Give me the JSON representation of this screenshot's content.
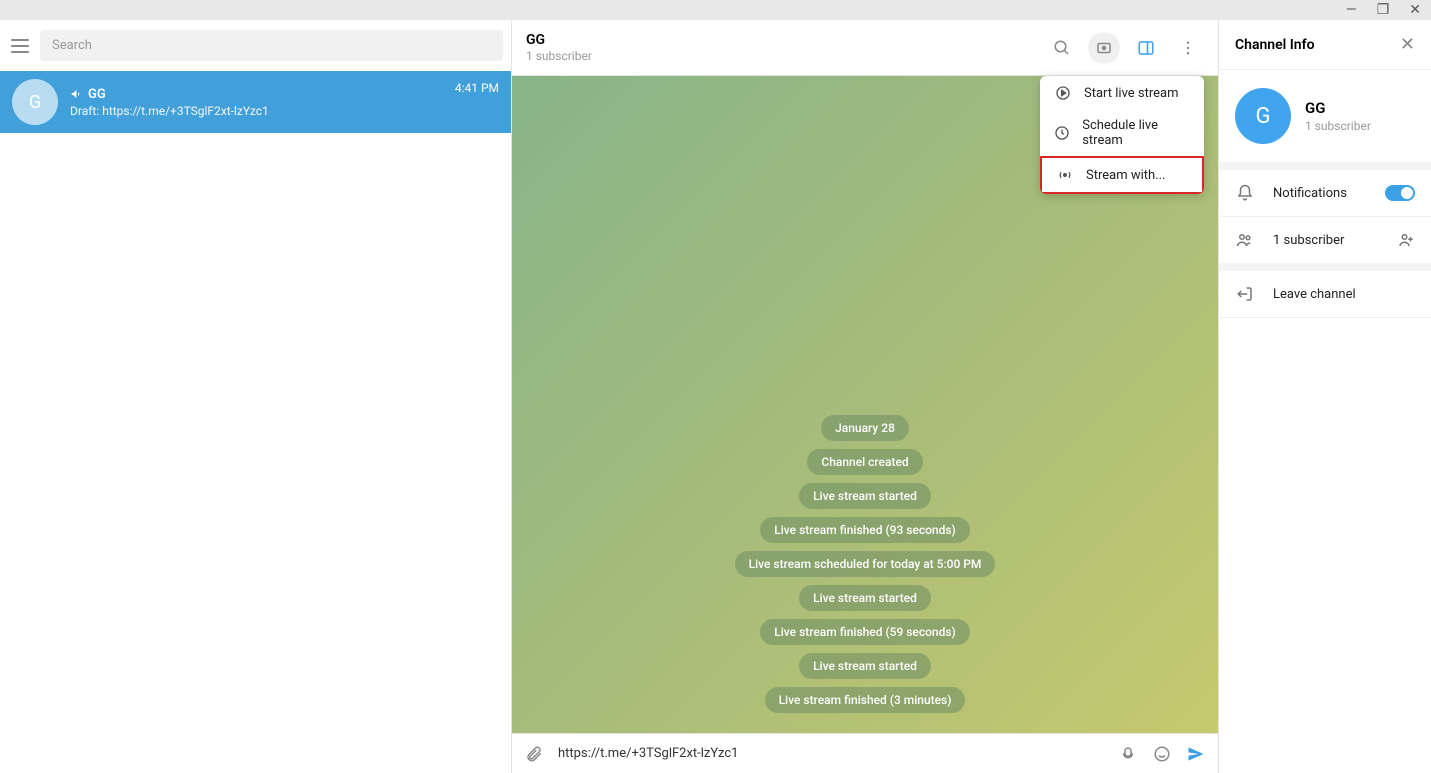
{
  "titlebar": {
    "minimize": "—",
    "maximize": "❐",
    "close": "✕"
  },
  "left": {
    "search_placeholder": "Search",
    "chat": {
      "avatar_letter": "G",
      "name": "GG",
      "time": "4:41 PM",
      "preview_label": "Draft: ",
      "preview_text": "https://t.me/+3TSglF2xt-lzYzc1"
    }
  },
  "middle": {
    "header": {
      "name": "GG",
      "sub": "1 subscriber"
    },
    "dropdown": [
      {
        "icon": "play",
        "label": "Start live stream"
      },
      {
        "icon": "clock",
        "label": "Schedule live stream"
      },
      {
        "icon": "broadcast",
        "label": "Stream with...",
        "highlight": true
      }
    ],
    "bubbles": [
      "January 28",
      "Channel created",
      "Live stream started",
      "Live stream finished (93 seconds)",
      "Live stream scheduled for today at 5:00 PM",
      "Live stream started",
      "Live stream finished (59 seconds)",
      "Live stream started",
      "Live stream finished (3 minutes)"
    ],
    "input_value": "https://t.me/+3TSglF2xt-lzYzc1"
  },
  "right": {
    "title": "Channel Info",
    "avatar_letter": "G",
    "name": "GG",
    "sub": "1 subscriber",
    "notifications_label": "Notifications",
    "subscribers_label": "1 subscriber",
    "leave_label": "Leave channel"
  }
}
